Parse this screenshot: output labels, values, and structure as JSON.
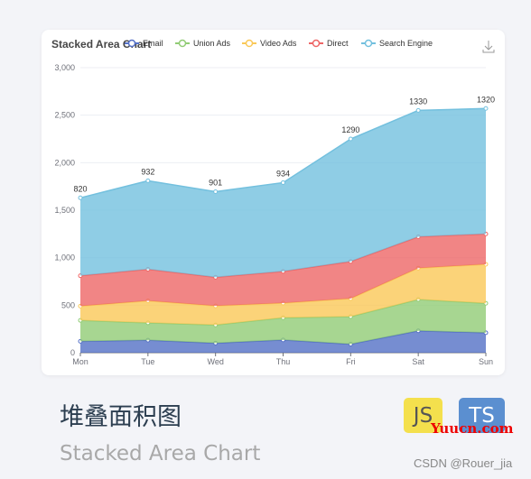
{
  "chart_data": {
    "type": "area",
    "stacked": true,
    "title": "Stacked Area Chart",
    "categories": [
      "Mon",
      "Tue",
      "Wed",
      "Thu",
      "Fri",
      "Sat",
      "Sun"
    ],
    "series": [
      {
        "name": "Email",
        "values": [
          120,
          132,
          101,
          134,
          90,
          230,
          210
        ],
        "color": "#5470c6"
      },
      {
        "name": "Union Ads",
        "values": [
          220,
          182,
          191,
          234,
          290,
          330,
          310
        ],
        "color": "#91cc75"
      },
      {
        "name": "Video Ads",
        "values": [
          150,
          232,
          201,
          154,
          190,
          330,
          410
        ],
        "color": "#fac858"
      },
      {
        "name": "Direct",
        "values": [
          320,
          332,
          301,
          334,
          390,
          330,
          320
        ],
        "color": "#ee6666"
      },
      {
        "name": "Search Engine",
        "values": [
          820,
          932,
          901,
          934,
          1290,
          1330,
          1320
        ],
        "color": "#73c0de"
      }
    ],
    "yticks": [
      "0",
      "500",
      "1,000",
      "1,500",
      "2,000",
      "2,500",
      "3,000"
    ],
    "ylim": [
      0,
      3000
    ],
    "data_labels_series": "Search Engine",
    "legend": "top",
    "grid": true,
    "toolbox": "save-as-image"
  },
  "footer": {
    "title_cn": "堆叠面积图",
    "title_en": "Stacked Area Chart",
    "badge_js": "JS",
    "badge_ts": "TS",
    "watermark": "Yuucn.com",
    "credit": "CSDN @Rouer_jia"
  }
}
